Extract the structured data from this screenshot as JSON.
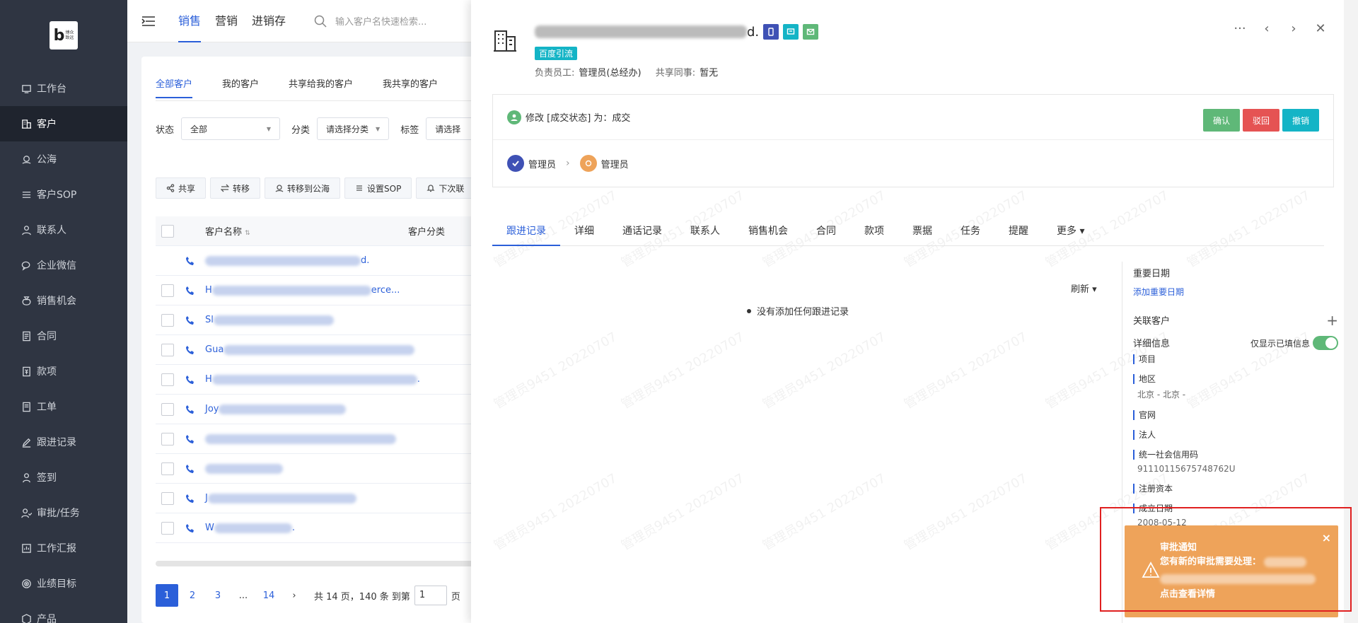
{
  "logo": {
    "letter": "b",
    "text_line1": "博众",
    "text_line2": "致远"
  },
  "sidebar": {
    "items": [
      {
        "label": "工作台",
        "icon": "desktop-icon",
        "active": false
      },
      {
        "label": "客户",
        "icon": "building-icon",
        "active": true
      },
      {
        "label": "公海",
        "icon": "sea-icon",
        "active": false
      },
      {
        "label": "客户SOP",
        "icon": "sop-icon",
        "active": false
      },
      {
        "label": "联系人",
        "icon": "person-icon",
        "active": false
      },
      {
        "label": "企业微信",
        "icon": "wechat-icon",
        "active": false
      },
      {
        "label": "销售机会",
        "icon": "money-bag-icon",
        "active": false
      },
      {
        "label": "合同",
        "icon": "contract-icon",
        "active": false
      },
      {
        "label": "款项",
        "icon": "payment-icon",
        "active": false
      },
      {
        "label": "工单",
        "icon": "ticket-icon",
        "active": false
      },
      {
        "label": "跟进记录",
        "icon": "edit-icon",
        "active": false
      },
      {
        "label": "签到",
        "icon": "checkin-icon",
        "active": false
      },
      {
        "label": "审批/任务",
        "icon": "approval-icon",
        "active": false
      },
      {
        "label": "工作汇报",
        "icon": "report-icon",
        "active": false
      },
      {
        "label": "业绩目标",
        "icon": "target-icon",
        "active": false
      },
      {
        "label": "产品",
        "icon": "product-icon",
        "active": false
      }
    ]
  },
  "topbar": {
    "tabs": [
      "销售",
      "营销",
      "进销存"
    ],
    "search_placeholder": "输入客户名快速检索..."
  },
  "list": {
    "tabs": [
      "全部客户",
      "我的客户",
      "共享给我的客户",
      "我共享的客户"
    ],
    "filters": {
      "status_label": "状态",
      "status_value": "全部",
      "category_label": "分类",
      "category_value": "请选择分类",
      "tag_label": "标签",
      "tag_value": "请选择"
    },
    "actions": [
      "共享",
      "转移",
      "转移到公海",
      "设置SOP",
      "下次联"
    ],
    "columns": {
      "name": "客户名称",
      "category": "客户分类"
    },
    "rows": [
      {
        "prefix": "",
        "suffix": "d.",
        "blur": 220
      },
      {
        "prefix": "H",
        "suffix": "erce...",
        "blur": 225
      },
      {
        "prefix": "Sl",
        "suffix": "",
        "blur": 170
      },
      {
        "prefix": "Gua",
        "suffix": "",
        "blur": 270
      },
      {
        "prefix": "H",
        "suffix": ".",
        "blur": 290
      },
      {
        "prefix": "Joy",
        "suffix": "",
        "blur": 180
      },
      {
        "prefix": "",
        "suffix": "",
        "blur": 270
      },
      {
        "prefix": "",
        "suffix": "",
        "blur": 110
      },
      {
        "prefix": "J",
        "suffix": "",
        "blur": 210
      },
      {
        "prefix": "W",
        "suffix": ".",
        "blur": 110
      }
    ],
    "pager": {
      "pages": [
        "1",
        "2",
        "3",
        "...",
        "14"
      ],
      "next": "›",
      "summary": "共 14 页，140 条 到第",
      "input_value": "1",
      "page_suffix": "页"
    }
  },
  "drawer": {
    "title_suffix": "d.",
    "tag": "百度引流",
    "owner_label": "负责员工:",
    "owner_value": "管理员(总经办)",
    "share_label": "共享同事:",
    "share_value": "暂无",
    "head_icons": [
      "···",
      "‹",
      "›",
      "✕"
    ],
    "approval": {
      "text": "修改 [成交状态] 为：成交",
      "confirm": "确认",
      "reject": "驳回",
      "revoke": "撤销",
      "step1": "管理员",
      "step2": "管理员"
    },
    "tabs": [
      "跟进记录",
      "详细",
      "通话记录",
      "联系人",
      "销售机会",
      "合同",
      "款项",
      "票据",
      "任务",
      "提醒",
      "更多 ▾"
    ],
    "refresh": "刷新 ▾",
    "empty_text": "没有添加任何跟进记录",
    "panel": {
      "important_dates": "重要日期",
      "add_important_date": "添加重要日期",
      "related_customers": "关联客户",
      "details": "详细信息",
      "only_filled": "仅显示已填信息",
      "fields": [
        {
          "label": "项目",
          "value": ""
        },
        {
          "label": "地区",
          "value": "北京 - 北京 -"
        },
        {
          "label": "官网",
          "value": ""
        },
        {
          "label": "法人",
          "value": ""
        },
        {
          "label": "统一社会信用码",
          "value": "91110115675748762U"
        },
        {
          "label": "注册资本",
          "value": ""
        },
        {
          "label": "成立日期",
          "value": "2008-05-12"
        }
      ]
    }
  },
  "watermark_text": "管理员9451 20220707",
  "notification": {
    "title": "审批通知",
    "message": "您有新的审批需要处理：",
    "link": "点击查看详情",
    "close": "×"
  },
  "colors": {
    "primary": "#2b5fd9",
    "sidebar_bg": "#2f3542",
    "confirm": "#5fb878",
    "reject": "#e55353",
    "revoke": "#14b4c6",
    "notify_bg": "#eea35a",
    "outline": "#e02020"
  }
}
